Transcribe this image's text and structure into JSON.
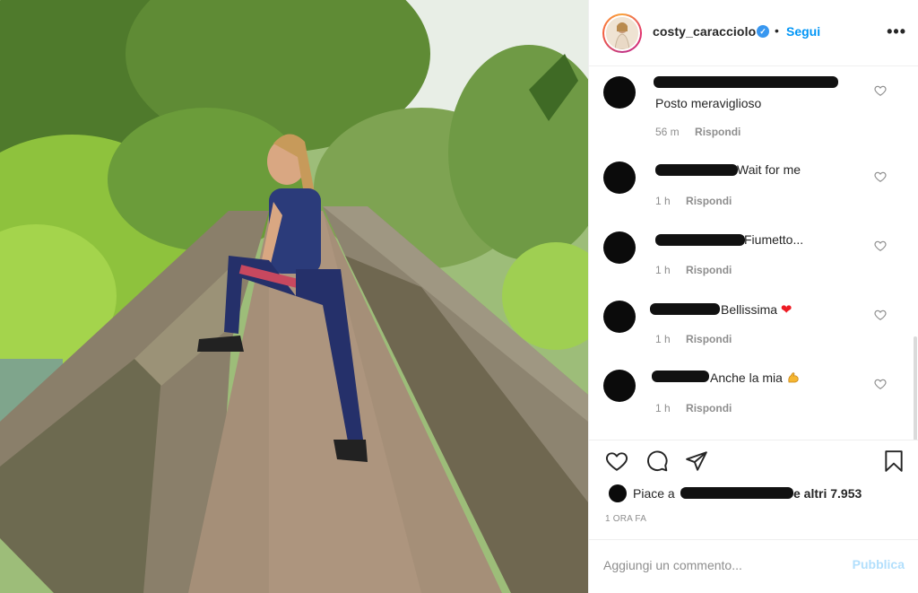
{
  "post": {
    "username": "costy_caracciolo",
    "verified": true,
    "separator": "•",
    "follow_label": "Segui",
    "more_label": "•••"
  },
  "comments": [
    {
      "text": "Posto meraviglioso",
      "time": "56 m",
      "reply": "Rispondi"
    },
    {
      "text": "Wait for me",
      "time": "1 h",
      "reply": "Rispondi"
    },
    {
      "text": "Fiumetto...",
      "time": "1 h",
      "reply": "Rispondi"
    },
    {
      "text": "Bellissima",
      "emoji": "red-heart",
      "time": "1 h",
      "reply": "Rispondi"
    },
    {
      "text": "Anche la mia",
      "emoji": "flexed-biceps",
      "time": "1 h",
      "reply": "Rispondi"
    }
  ],
  "likes": {
    "prefix": "Piace a",
    "suffix": "e altri 7.953"
  },
  "time_ago": "1 ORA FA",
  "add_comment": {
    "placeholder": "Aggiungi un commento...",
    "publish_label": "Pubblica"
  },
  "icons": {
    "like": "heart-icon",
    "comment": "comment-icon",
    "share": "paper-plane-icon",
    "save": "bookmark-icon",
    "more": "more-options-icon",
    "verified": "verified-badge-icon"
  },
  "colors": {
    "accent": "#0095f6",
    "verified": "#3897f0",
    "muted": "#8e8e8e",
    "publish_disabled": "#b2dffc"
  }
}
